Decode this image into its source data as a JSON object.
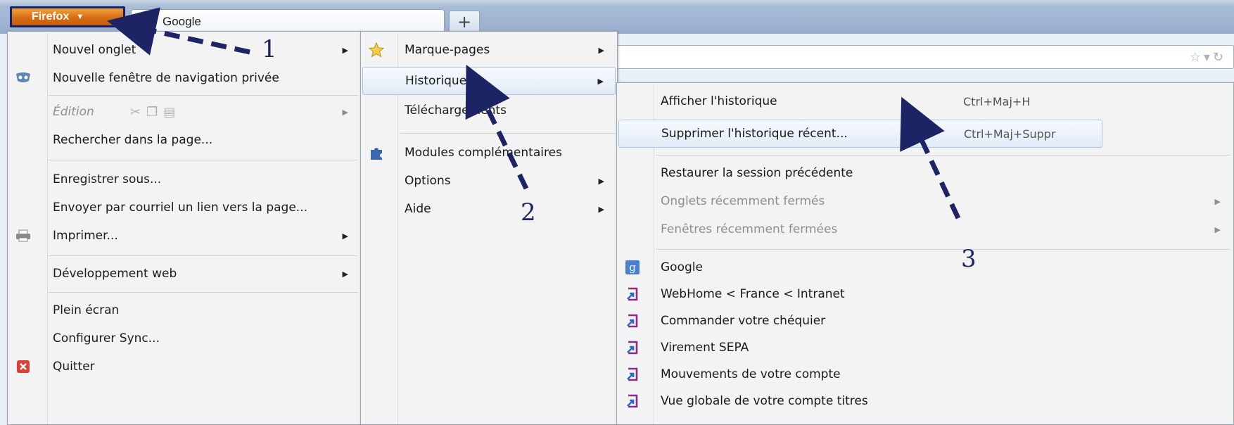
{
  "browser": {
    "app_button": "Firefox",
    "tab_title": "Google",
    "new_tab_label": "+"
  },
  "main_menu": {
    "items": [
      {
        "label": "Nouvel onglet",
        "submenu": true
      },
      {
        "label": "Nouvelle fenêtre de navigation privée",
        "icon": "private-mask-icon"
      },
      {
        "label": "Édition",
        "disabled": true,
        "submenu": true,
        "icons": [
          "cut-icon",
          "copy-icon",
          "paste-icon"
        ]
      },
      {
        "label": "Rechercher dans la page..."
      },
      {
        "label": "Enregistrer sous..."
      },
      {
        "label": "Envoyer par courriel un lien vers la page..."
      },
      {
        "label": "Imprimer...",
        "icon": "printer-icon",
        "submenu": true
      },
      {
        "label": "Développement web",
        "submenu": true
      },
      {
        "label": "Plein écran"
      },
      {
        "label": "Configurer Sync..."
      },
      {
        "label": "Quitter",
        "icon": "quit-icon"
      }
    ]
  },
  "second_menu": {
    "items": [
      {
        "label": "Marque-pages",
        "icon": "star-icon",
        "submenu": true
      },
      {
        "label": "Historique",
        "submenu": true,
        "highlighted": true
      },
      {
        "label": "Téléchargements"
      },
      {
        "label": "Modules complémentaires",
        "icon": "puzzle-icon"
      },
      {
        "label": "Options",
        "submenu": true
      },
      {
        "label": "Aide",
        "submenu": true
      }
    ]
  },
  "history_menu": {
    "items": [
      {
        "label": "Afficher l'historique",
        "shortcut": "Ctrl+Maj+H"
      },
      {
        "label": "Supprimer l'historique récent...",
        "shortcut": "Ctrl+Maj+Suppr",
        "highlighted": true
      },
      {
        "label": "Restaurer la session précédente"
      },
      {
        "label": "Onglets récemment fermés",
        "disabled": true,
        "submenu": true
      },
      {
        "label": "Fenêtres récemment fermées",
        "disabled": true,
        "submenu": true
      },
      {
        "label": "Google",
        "icon": "google-icon"
      },
      {
        "label": "WebHome < France < Intranet",
        "icon": "site-icon"
      },
      {
        "label": "Commander votre chéquier",
        "icon": "site-icon"
      },
      {
        "label": "Virement SEPA",
        "icon": "site-icon"
      },
      {
        "label": "Mouvements de votre compte",
        "icon": "site-icon"
      },
      {
        "label": "Vue globale de votre compte titres",
        "icon": "site-icon"
      }
    ]
  },
  "annotations": {
    "n1": "1",
    "n2": "2",
    "n3": "3"
  },
  "colors": {
    "arrow": "#1c2465",
    "firefox_button": "#d66c14",
    "highlight_border": "#a9c3e3"
  }
}
